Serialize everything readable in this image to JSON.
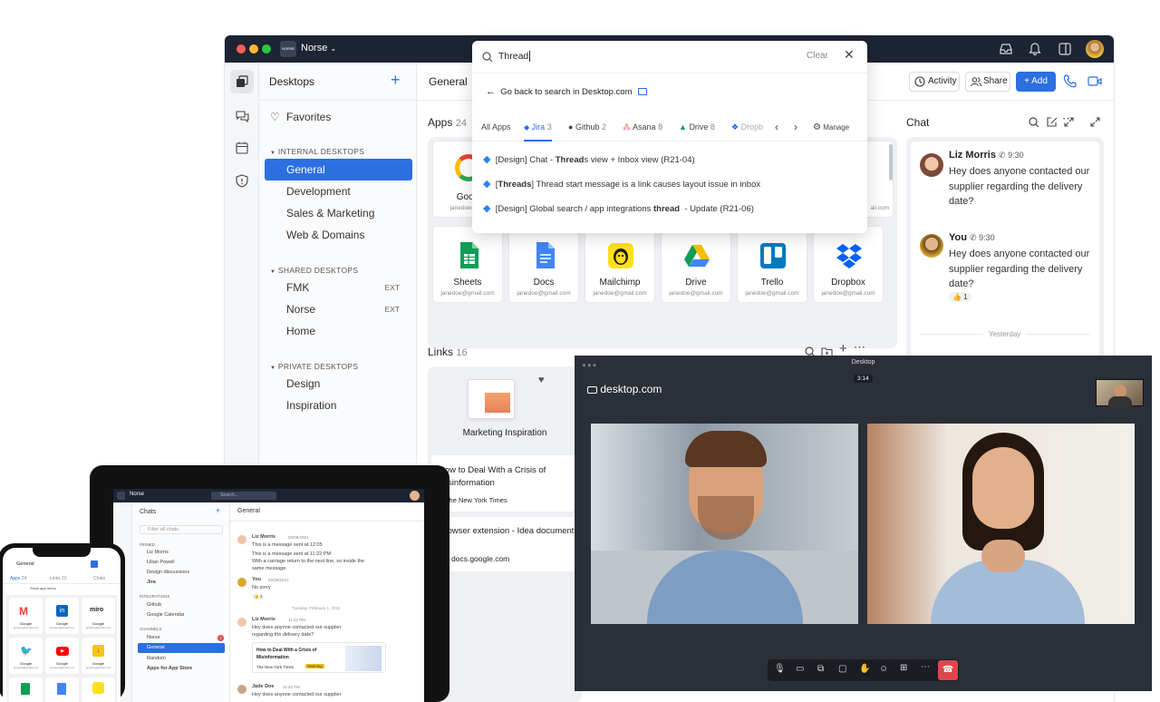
{
  "window": {
    "workspace": "Norse",
    "logo_text": "NORSE"
  },
  "sidebar": {
    "title": "Desktops",
    "favorites": "Favorites",
    "sections": [
      {
        "label": "INTERNAL DESKTOPS",
        "items": [
          {
            "label": "General"
          },
          {
            "label": "Development"
          },
          {
            "label": "Sales & Marketing"
          },
          {
            "label": "Web & Domains"
          }
        ]
      },
      {
        "label": "SHARED DESKTOPS",
        "items": [
          {
            "label": "FMK",
            "badge": "EXT"
          },
          {
            "label": "Norse",
            "badge": "EXT"
          },
          {
            "label": "Home"
          }
        ]
      },
      {
        "label": "PRIVATE DESKTOPS",
        "items": [
          {
            "label": "Design"
          },
          {
            "label": "Inspiration"
          }
        ]
      }
    ]
  },
  "main": {
    "desktop_name": "General",
    "toolbar": {
      "activity": "Activity",
      "share": "Share",
      "add": "+ Add"
    },
    "apps_label": "Apps",
    "apps_count": "24",
    "apps_row1": [
      {
        "name": "Goog",
        "email": "janedoe@gm"
      }
    ],
    "apps_row1_right_email": "ail.com",
    "apps_row2": [
      {
        "name": "Sheets",
        "email": "janedoe@gmail.com",
        "icon": "sheets-icon"
      },
      {
        "name": "Docs",
        "email": "janedoe@gmail.com",
        "icon": "docs-icon"
      },
      {
        "name": "Mailchimp",
        "email": "janedoe@gmail.com",
        "icon": "mailchimp-icon"
      },
      {
        "name": "Drive",
        "email": "janedoe@gmail.com",
        "icon": "drive-icon"
      },
      {
        "name": "Trello",
        "email": "janedoe@gmail.com",
        "icon": "trello-icon"
      },
      {
        "name": "Dropbox",
        "email": "janedoe@gmail.com",
        "icon": "dropbox-icon"
      }
    ],
    "links_label": "Links",
    "links_count": "16",
    "link_card": "Marketing Inspiration",
    "links": [
      {
        "title": "How to Deal With a Crisis of Misinformation",
        "source": "The New York Times"
      },
      {
        "title": "Browser extension - Idea document",
        "source": "docs.google.com"
      }
    ]
  },
  "chat": {
    "title": "Chat",
    "messages": [
      {
        "author": "Liz Morris",
        "time": "9:30",
        "text": "Hey does anyone contacted our supplier regarding the delivery date?"
      },
      {
        "author": "You",
        "time": "9:30",
        "text": "Hey does anyone contacted our supplier regarding the delivery date?",
        "reaction": "👍 1"
      }
    ],
    "divider": "Yesterday"
  },
  "search": {
    "query": "Thread",
    "clear": "Clear",
    "back": "Go back to search in Desktop.com",
    "tabs": [
      {
        "label": "All Apps"
      },
      {
        "label": "Jira",
        "count": "3"
      },
      {
        "label": "Github",
        "count": "2"
      },
      {
        "label": "Asana",
        "count": "8"
      },
      {
        "label": "Drive",
        "count": "8"
      },
      {
        "label": "Dropb"
      }
    ],
    "manage": "Manage",
    "results": [
      {
        "pre": "[Design] Chat - ",
        "hl": "Thread",
        "post": "s view + Inbox view (R21-04)"
      },
      {
        "pre": "[",
        "hl": "Threads",
        "post": "] Thread start message is a link causes layout issue in inbox"
      },
      {
        "pre": "[Design] Global search / app integrations ",
        "hl": "thread",
        "post": "  - Update (R21-06)"
      }
    ]
  },
  "video": {
    "title": "Desktop",
    "brand": "desktop.com",
    "timer": "3:14"
  },
  "tablet": {
    "workspace": "Norse",
    "search": "Search...",
    "chats": "Chats",
    "filter": "Filter all chats",
    "pinned": "PINNED",
    "pinned_items": [
      "Liz Morris",
      "Lilian Powell",
      "Design discussions",
      "Jira"
    ],
    "integrations": "INTEGRATIONS",
    "integration_items": [
      "Github",
      "Google Calendar"
    ],
    "channels": "CHANNELS",
    "channel_items": [
      "Norse",
      "General",
      "Random",
      "Apps for App Store"
    ],
    "channel_badge": "2",
    "chat_title": "General",
    "msgs": [
      {
        "author": "Liz Morris",
        "date": "02/06/2021",
        "lines": [
          "This is a message sent at 12:05",
          "This is a message sent at 11:22 PM",
          "With a carriage return to the next line, so inside the",
          "same message"
        ]
      },
      {
        "author": "You",
        "date": "02/06/2021",
        "lines": [
          "No sorry"
        ],
        "reaction": "👍 1"
      },
      {
        "author": "Liz Morris",
        "date": "11:22 PM",
        "lines": [
          "Hey does anyone contacted our supplier",
          "regarding the delivery date?"
        ]
      },
      {
        "author": "Jade Doe",
        "date": "11:22 PM",
        "lines": [
          "Hey does anyone contacted our supplier"
        ]
      }
    ],
    "day_divider": "Tuesday, February 1, 2022",
    "link_preview": {
      "title": "How to Deal With a Crisis of Misinformation",
      "source": "The New York Times",
      "tag": "Warning"
    }
  },
  "phone": {
    "workspace": "General",
    "tabs": [
      "Apps",
      "Links",
      "Chats"
    ],
    "apps_count": "24",
    "links_count": "16",
    "show_menu": "Show app menu",
    "apps": [
      {
        "name": "Google",
        "icon": "gmail-icon"
      },
      {
        "name": "Google",
        "icon": "linkedin-icon"
      },
      {
        "name": "Google",
        "icon": "miro-icon"
      },
      {
        "name": "Google",
        "icon": "twitter-icon"
      },
      {
        "name": "Google",
        "icon": "youtube-icon"
      },
      {
        "name": "Google",
        "icon": "download-icon"
      }
    ],
    "email": "janedoe@gmail.com"
  }
}
